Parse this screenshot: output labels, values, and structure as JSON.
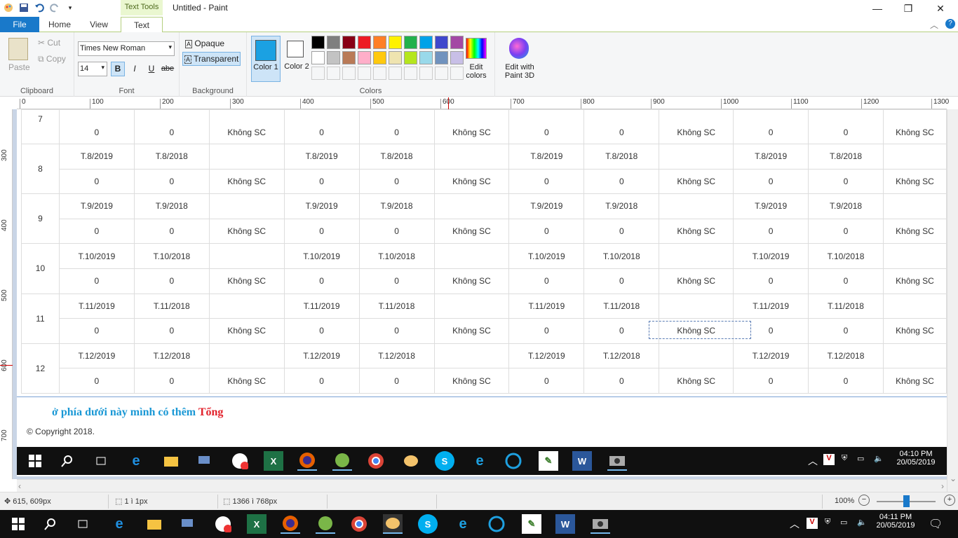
{
  "titlebar": {
    "context_tab": "Text Tools",
    "title": "Untitled - Paint"
  },
  "tabs": [
    "File",
    "Home",
    "View",
    "Text"
  ],
  "ribbon": {
    "clipboard": {
      "paste": "Paste",
      "cut": "Cut",
      "copy": "Copy",
      "label": "Clipboard"
    },
    "font": {
      "family": "Times New Roman",
      "size": "14",
      "bold": "B",
      "italic": "I",
      "underline": "U",
      "strike": "abe",
      "label": "Font"
    },
    "background": {
      "opaque": "Opaque",
      "transparent": "Transparent",
      "label": "Background"
    },
    "colors": {
      "color1": "Color 1",
      "color2": "Color 2",
      "label": "Colors",
      "edit": "Edit colors",
      "color1_value": "#1ba1e2",
      "palette_row1": [
        "#000000",
        "#7f7f7f",
        "#880015",
        "#ed1c24",
        "#ff7f27",
        "#fff200",
        "#22b14c",
        "#00a2e8",
        "#3f48cc",
        "#a349a4"
      ],
      "palette_row2": [
        "#ffffff",
        "#c3c3c3",
        "#b97a57",
        "#ffaec9",
        "#ffc90e",
        "#efe4b0",
        "#b5e61d",
        "#99d9ea",
        "#7092be",
        "#c8bfe7"
      ]
    },
    "paint3d": "Edit with Paint 3D"
  },
  "ruler_h": [
    "0",
    "100",
    "200",
    "300",
    "400",
    "500",
    "600",
    "700",
    "800",
    "900",
    "1000",
    "1100",
    "1200",
    "1300"
  ],
  "ruler_v": [
    "300",
    "400",
    "500",
    "600",
    "700"
  ],
  "table": {
    "rows": [
      {
        "num": "7",
        "top": null,
        "bottom": [
          "0",
          "0",
          "Không SC",
          "0",
          "0",
          "Không SC",
          "0",
          "0",
          "Không SC",
          "0",
          "0",
          "Không SC"
        ]
      },
      {
        "num": "8",
        "top": [
          "T.8/2019",
          "T.8/2018",
          "",
          "T.8/2019",
          "T.8/2018",
          "",
          "T.8/2019",
          "T.8/2018",
          "",
          "T.8/2019",
          "T.8/2018",
          ""
        ],
        "bottom": [
          "0",
          "0",
          "Không SC",
          "0",
          "0",
          "Không SC",
          "0",
          "0",
          "Không SC",
          "0",
          "0",
          "Không SC"
        ]
      },
      {
        "num": "9",
        "top": [
          "T.9/2019",
          "T.9/2018",
          "",
          "T.9/2019",
          "T.9/2018",
          "",
          "T.9/2019",
          "T.9/2018",
          "",
          "T.9/2019",
          "T.9/2018",
          ""
        ],
        "bottom": [
          "0",
          "0",
          "Không SC",
          "0",
          "0",
          "Không SC",
          "0",
          "0",
          "Không SC",
          "0",
          "0",
          "Không SC"
        ]
      },
      {
        "num": "10",
        "top": [
          "T.10/2019",
          "T.10/2018",
          "",
          "T.10/2019",
          "T.10/2018",
          "",
          "T.10/2019",
          "T.10/2018",
          "",
          "T.10/2019",
          "T.10/2018",
          ""
        ],
        "bottom": [
          "0",
          "0",
          "Không SC",
          "0",
          "0",
          "Không SC",
          "0",
          "0",
          "Không SC",
          "0",
          "0",
          "Không SC"
        ]
      },
      {
        "num": "11",
        "top": [
          "T.11/2019",
          "T.11/2018",
          "",
          "T.11/2019",
          "T.11/2018",
          "",
          "T.11/2019",
          "T.11/2018",
          "",
          "T.11/2019",
          "T.11/2018",
          ""
        ],
        "bottom": [
          "0",
          "0",
          "Không SC",
          "0",
          "0",
          "Không SC",
          "0",
          "0",
          "Không SC",
          "0",
          "0",
          "Không SC"
        ]
      },
      {
        "num": "12",
        "top": [
          "T.12/2019",
          "T.12/2018",
          "",
          "T.12/2019",
          "T.12/2018",
          "",
          "T.12/2019",
          "T.12/2018",
          "",
          "T.12/2019",
          "T.12/2018",
          ""
        ],
        "bottom": [
          "0",
          "0",
          "Không SC",
          "0",
          "0",
          "Không SC",
          "0",
          "0",
          "Không SC",
          "0",
          "0",
          "Không SC"
        ]
      }
    ]
  },
  "note": {
    "text": "ở phía dưới này mình có thêm ",
    "highlight": "Tổng"
  },
  "copyright": "© Copyright 2018.",
  "inner_taskbar": {
    "time": "04:10 PM",
    "date": "20/05/2019"
  },
  "statusbar": {
    "cursor": "615, 609px",
    "selection": "1 ì 1px",
    "size": "1366 ì 768px",
    "zoom": "100%"
  },
  "taskbar": {
    "time": "04:11 PM",
    "date": "20/05/2019"
  }
}
